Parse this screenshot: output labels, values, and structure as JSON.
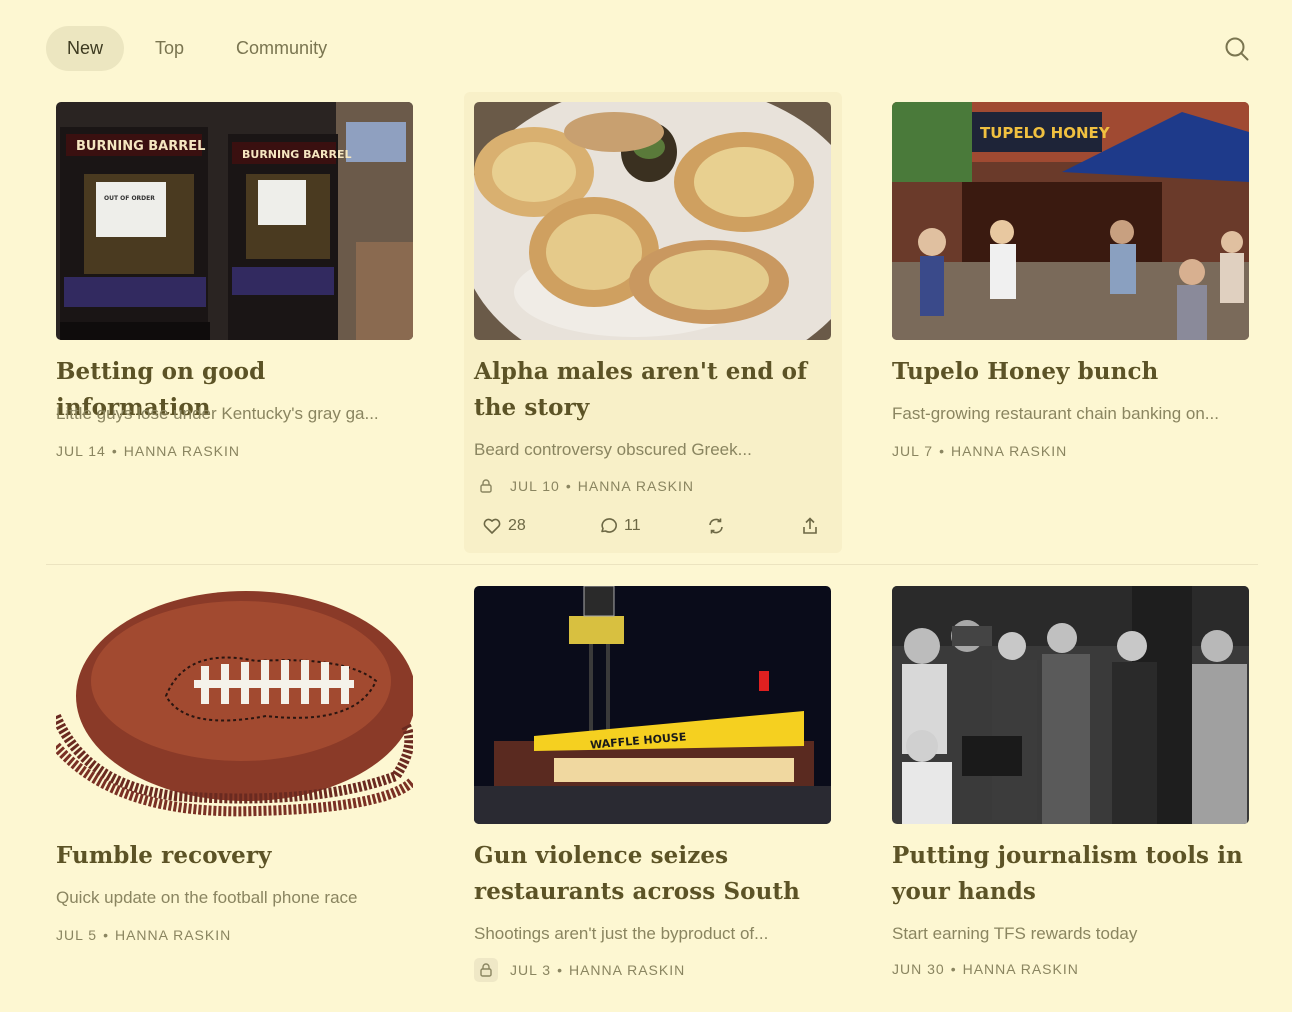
{
  "nav": {
    "tabs": [
      {
        "label": "New",
        "active": true
      },
      {
        "label": "Top",
        "active": false
      },
      {
        "label": "Community",
        "active": false
      }
    ],
    "search_icon": "search-icon"
  },
  "posts": [
    {
      "title": "Betting on good information",
      "subtitle": "Little guys lose under Kentucky's gray ga...",
      "date": "JUL 14",
      "author": "HANNA RASKIN",
      "image": "arcade betting machines out of order",
      "image_text_left": "BURNING BARREL",
      "image_text_right": "BURNING BARREL",
      "image_sign": "OUT OF ORDER"
    },
    {
      "title": "Alpha males aren't end of the story",
      "subtitle": "Beard controversy obscured Greek...",
      "date": "JUL 10",
      "author": "HANNA RASKIN",
      "paywalled": true,
      "image": "baked oysters on a plate",
      "likes": "28",
      "comments": "11"
    },
    {
      "title": "Tupelo Honey bunch",
      "subtitle": "Fast-growing restaurant chain banking on...",
      "date": "JUL 7",
      "author": "HANNA RASKIN",
      "image": "restaurant storefront with patio",
      "image_sign": "TUPELO HONEY"
    },
    {
      "title": "Fumble recovery",
      "subtitle": "Quick update on the football phone race",
      "date": "JUL 5",
      "author": "HANNA RASKIN",
      "image": "football shaped telephone"
    },
    {
      "title": "Gun violence seizes restaurants across South",
      "subtitle": "Shootings aren't just the byproduct of...",
      "date": "JUL 3",
      "author": "HANNA RASKIN",
      "paywalled": true,
      "image": "waffle house at night",
      "image_sign": "WAFFLE HOUSE"
    },
    {
      "title": "Putting journalism tools in your hands",
      "subtitle": "Start earning TFS rewards today",
      "date": "JUN 30",
      "author": "HANNA RASKIN",
      "image": "vintage black and white press photo"
    }
  ],
  "meta_separator": "•",
  "colors": {
    "background": "#fdf7d2",
    "active_tab": "#ece6c0",
    "title": "#5c5326",
    "muted": "#8a8560"
  }
}
